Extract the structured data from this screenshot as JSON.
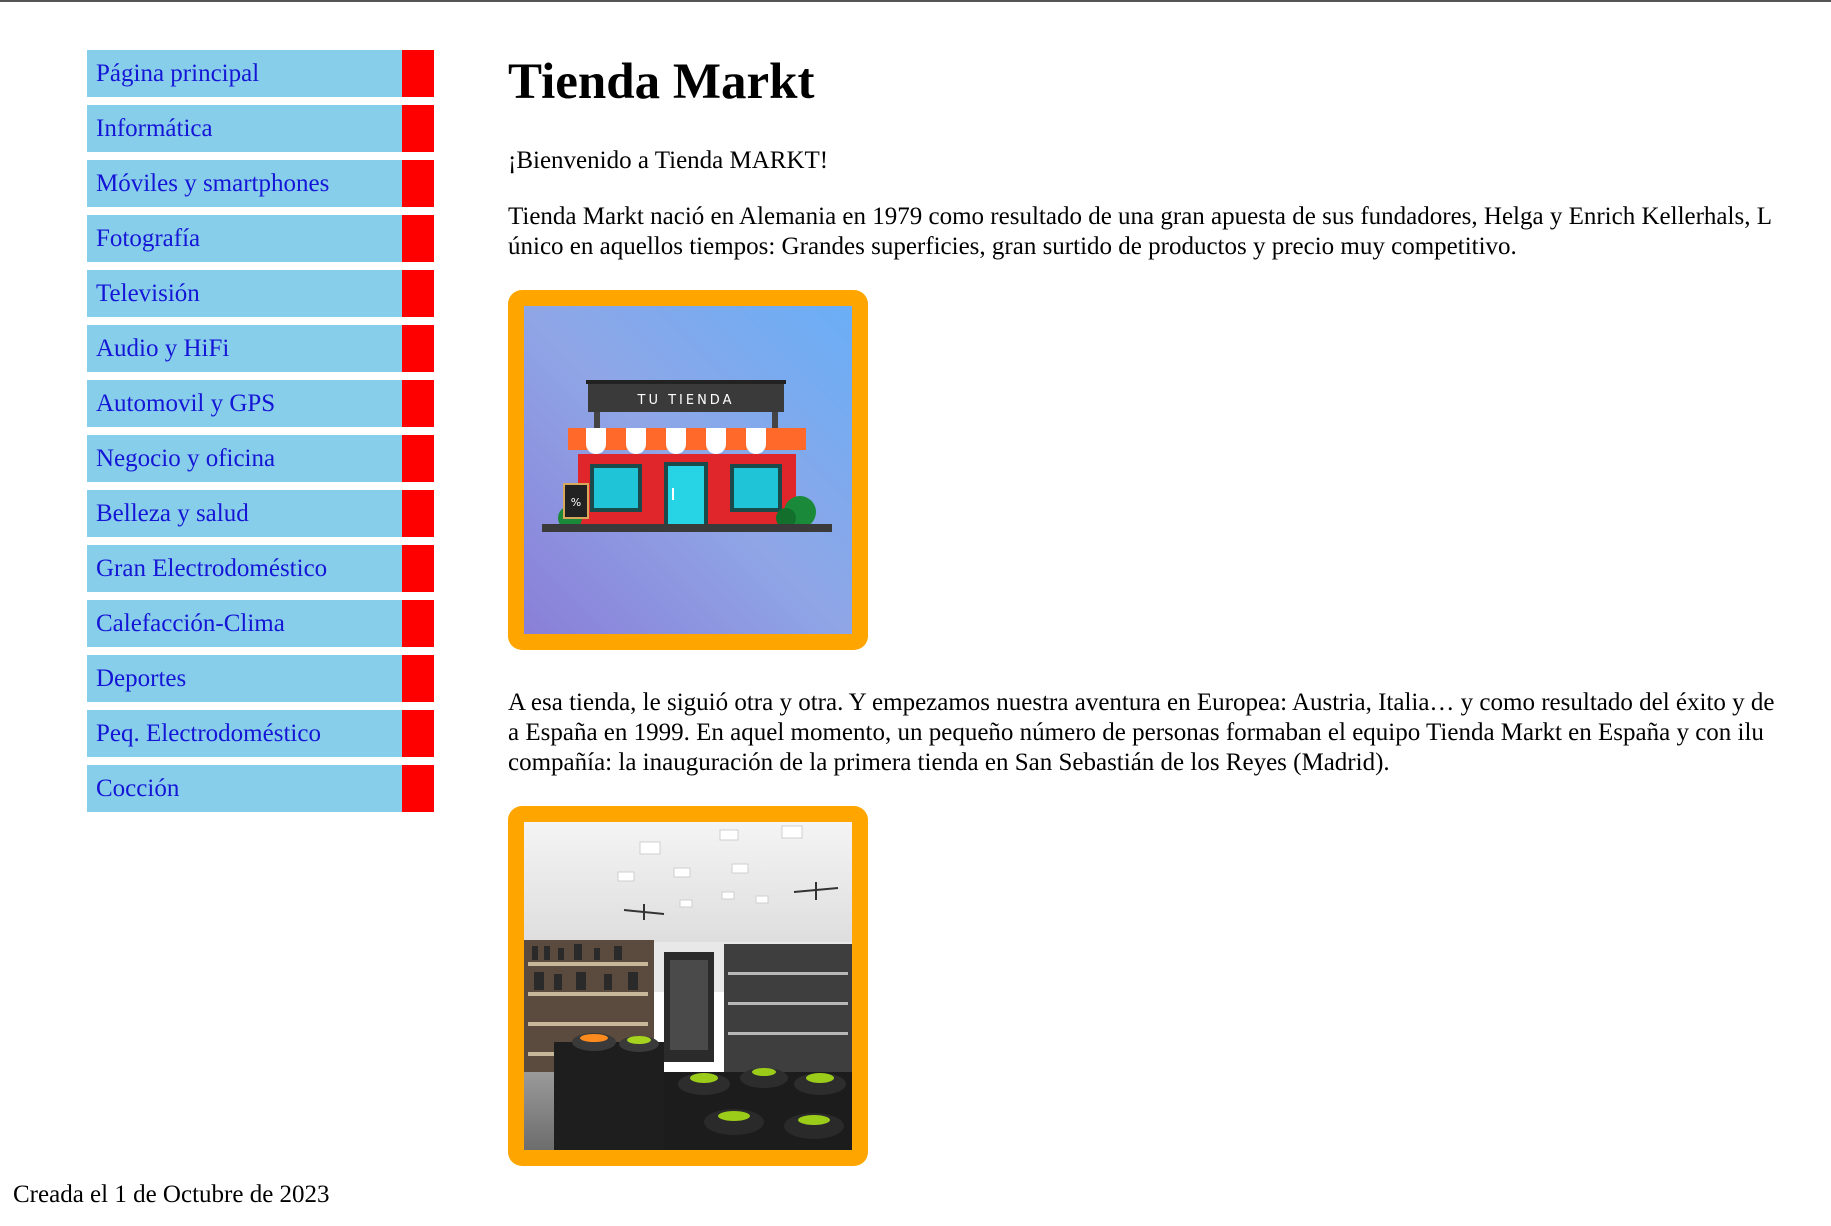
{
  "nav": {
    "items": [
      {
        "label": "Página principal"
      },
      {
        "label": "Informática"
      },
      {
        "label": "Móviles y smartphones"
      },
      {
        "label": "Fotografía"
      },
      {
        "label": "Televisión"
      },
      {
        "label": "Audio y HiFi"
      },
      {
        "label": "Automovil y GPS"
      },
      {
        "label": "Negocio y oficina"
      },
      {
        "label": "Belleza y salud"
      },
      {
        "label": "Gran Electrodoméstico"
      },
      {
        "label": "Calefacción-Clima"
      },
      {
        "label": "Deportes"
      },
      {
        "label": "Peq. Electrodoméstico"
      },
      {
        "label": "Cocción"
      }
    ],
    "colors": {
      "background": "#87ceeb",
      "marker": "#ff0000",
      "link": "#1515d6"
    }
  },
  "main": {
    "title": "Tienda Markt",
    "welcome": "¡Bienvenido a Tienda MARKT!",
    "paragraph1_line1": "Tienda Markt nació en Alemania en 1979 como resultado de una gran apuesta de sus fundadores, Helga y Enrich Kellerhals, L",
    "paragraph1_line2": "único en aquellos tiempos: Grandes superficies, gran surtido de productos y precio muy competitivo.",
    "image1": {
      "sign_text": "TU TIENDA",
      "tag_text": "%"
    },
    "paragraph2_line1": "A esa tienda, le siguió otra y otra. Y empezamos nuestra aventura en Europea: Austria, Italia… y como resultado del éxito y de",
    "paragraph2_line2": "a España en 1999. En aquel momento, un pequeño número de personas formaban el equipo Tienda Markt en España y con ilu",
    "paragraph2_line3": "compañía: la inauguración de la primera tienda en San Sebastián de los Reyes (Madrid).",
    "frame_color": "#ffa500"
  },
  "footer": {
    "text": "Creada el 1 de Octubre de 2023"
  }
}
